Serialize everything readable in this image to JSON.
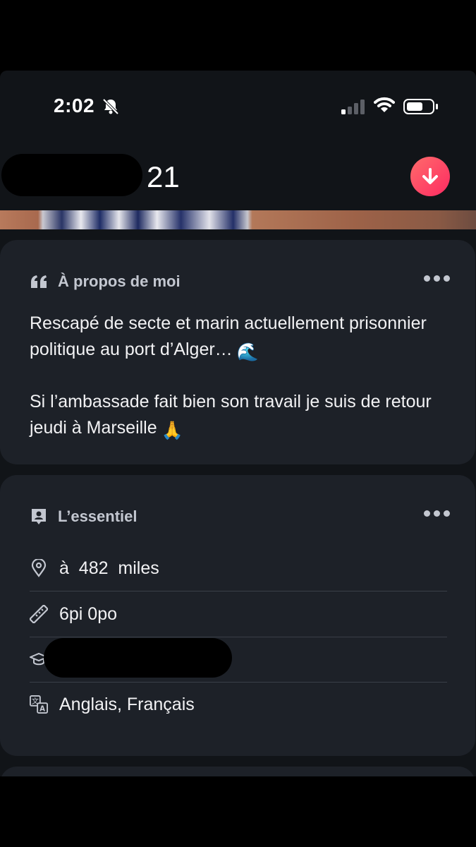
{
  "status_bar": {
    "time": "2:02",
    "icons": [
      "bell-slash-icon",
      "signal-icon",
      "wifi-icon",
      "battery-icon"
    ]
  },
  "profile": {
    "age": "21",
    "action_icon": "arrow-down-icon",
    "accent": "#fd4a66"
  },
  "about": {
    "title": "À propos de moi",
    "icon": "quote-icon",
    "paragraphs": [
      "Rescapé de secte et marin actuellement prisonnier politique au port d’Alger…",
      "Si l’ambassade fait bien son travail je suis de retour jeudi à Marseille"
    ],
    "emojis": [
      "🌊",
      "🙏"
    ]
  },
  "basics": {
    "title": "L’essentiel",
    "icon": "id-badge-icon",
    "distance": "à  482  miles",
    "height": "6pi 0po",
    "languages": "Anglais, Français"
  }
}
